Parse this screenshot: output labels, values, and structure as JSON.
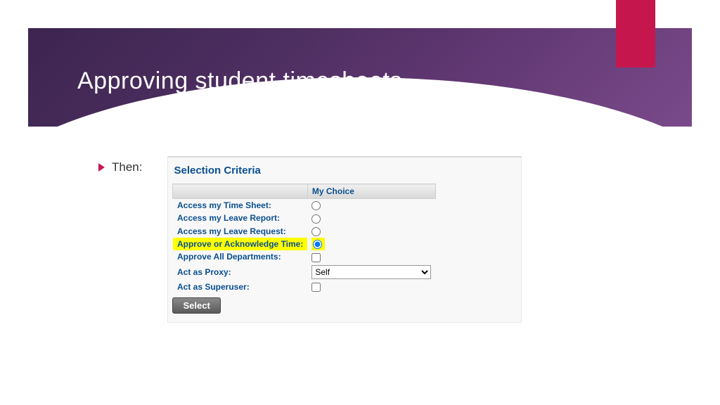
{
  "header": {
    "title": "Approving student timesheets"
  },
  "bullet": {
    "text": "Then:"
  },
  "panel": {
    "title": "Selection Criteria",
    "column_header": "My Choice",
    "rows": {
      "time_sheet": {
        "label": "Access my Time Sheet:"
      },
      "leave_report": {
        "label": "Access my Leave Report:"
      },
      "leave_request": {
        "label": "Access my Leave Request:"
      },
      "approve_ack": {
        "label": "Approve or Acknowledge Time:"
      },
      "approve_all": {
        "label": "Approve All Departments:"
      },
      "proxy": {
        "label": "Act as Proxy:",
        "selected": "Self"
      },
      "superuser": {
        "label": "Act as Superuser:"
      }
    },
    "select_button": "Select"
  }
}
